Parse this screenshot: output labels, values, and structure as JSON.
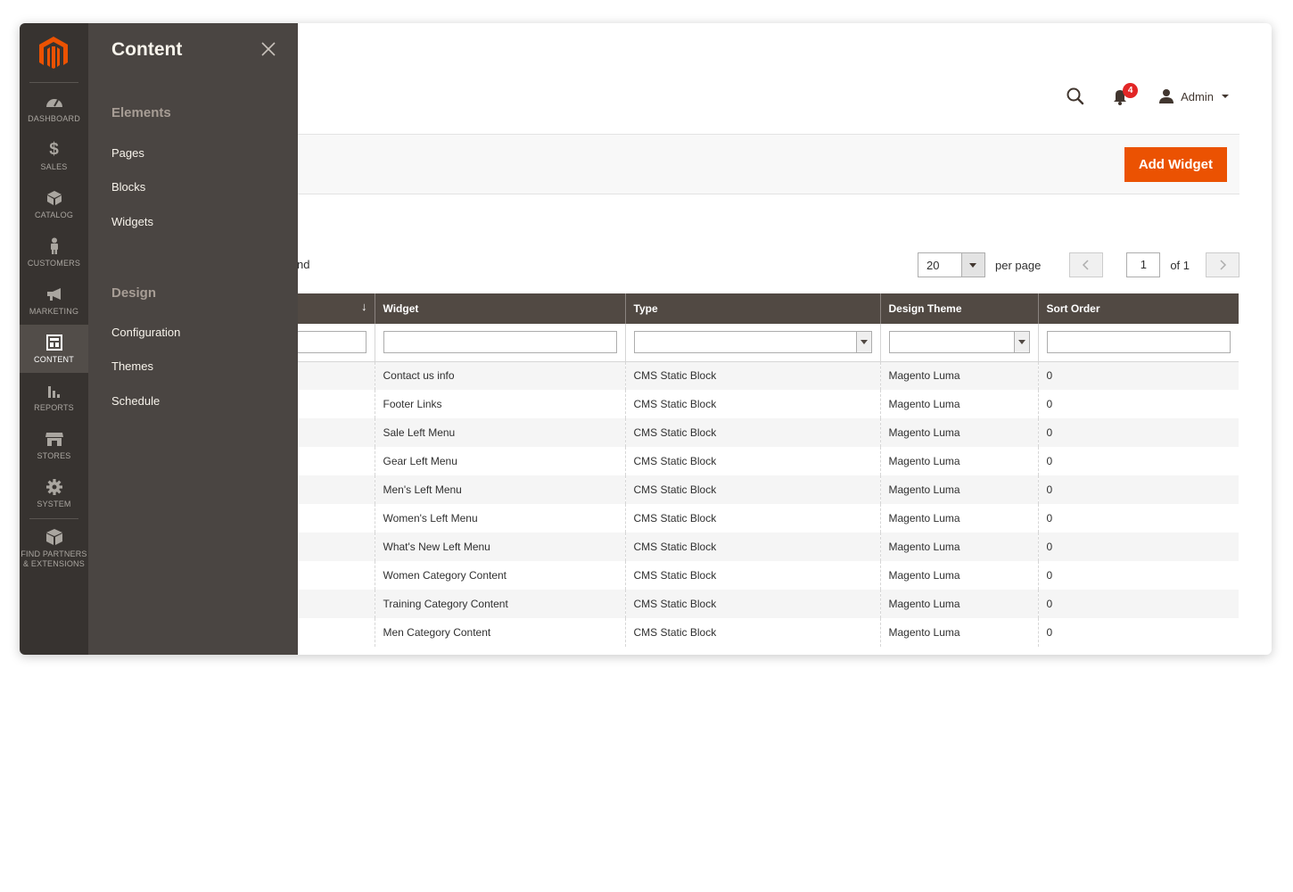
{
  "colors": {
    "accent": "#eb5202",
    "nav_bg": "#373330",
    "submenu_bg": "#4a4542",
    "grid_header_bg": "#514943",
    "badge": "#e22626"
  },
  "header": {
    "search_icon": "search-icon",
    "notifications_count": "4",
    "user_name": "Admin"
  },
  "actions": {
    "add_widget_label": "Add Widget"
  },
  "grid_toolbar": {
    "records_found_fragment": "nd",
    "per_page_value": "20",
    "per_page_label": "per page",
    "current_page": "1",
    "page_of": "of 1"
  },
  "grid": {
    "columns": [
      "",
      "Widget",
      "Type",
      "Design Theme",
      "Sort Order"
    ],
    "rows": [
      {
        "widget": "Contact us info",
        "type": "CMS Static Block",
        "theme": "Magento Luma",
        "sort": "0"
      },
      {
        "widget": "Footer Links",
        "type": "CMS Static Block",
        "theme": "Magento Luma",
        "sort": "0"
      },
      {
        "widget": "Sale Left Menu",
        "type": "CMS Static Block",
        "theme": "Magento Luma",
        "sort": "0"
      },
      {
        "widget": "Gear Left Menu",
        "type": "CMS Static Block",
        "theme": "Magento Luma",
        "sort": "0"
      },
      {
        "widget": "Men's Left Menu",
        "type": "CMS Static Block",
        "theme": "Magento Luma",
        "sort": "0"
      },
      {
        "widget": "Women's Left Menu",
        "type": "CMS Static Block",
        "theme": "Magento Luma",
        "sort": "0"
      },
      {
        "widget": "What's New Left Menu",
        "type": "CMS Static Block",
        "theme": "Magento Luma",
        "sort": "0"
      },
      {
        "widget": "Women Category Content",
        "type": "CMS Static Block",
        "theme": "Magento Luma",
        "sort": "0"
      },
      {
        "widget": "Training Category Content",
        "type": "CMS Static Block",
        "theme": "Magento Luma",
        "sort": "0"
      },
      {
        "widget": "Men Category Content",
        "type": "CMS Static Block",
        "theme": "Magento Luma",
        "sort": "0"
      }
    ]
  },
  "nav": {
    "items": [
      {
        "label": "Dashboard",
        "icon": "dashboard-icon"
      },
      {
        "label": "Sales",
        "icon": "dollar-icon"
      },
      {
        "label": "Catalog",
        "icon": "cube-icon"
      },
      {
        "label": "Customers",
        "icon": "person-icon"
      },
      {
        "label": "Marketing",
        "icon": "megaphone-icon"
      },
      {
        "label": "Content",
        "icon": "layout-icon"
      },
      {
        "label": "Reports",
        "icon": "bar-chart-icon"
      },
      {
        "label": "Stores",
        "icon": "storefront-icon"
      },
      {
        "label": "System",
        "icon": "gear-icon"
      }
    ],
    "partners_line1": "Find Partners",
    "partners_line2": "& Extensions"
  },
  "submenu": {
    "title": "Content",
    "groups": [
      {
        "title": "Elements",
        "links": [
          "Pages",
          "Blocks",
          "Widgets"
        ]
      },
      {
        "title": "Design",
        "links": [
          "Configuration",
          "Themes",
          "Schedule"
        ]
      }
    ]
  }
}
